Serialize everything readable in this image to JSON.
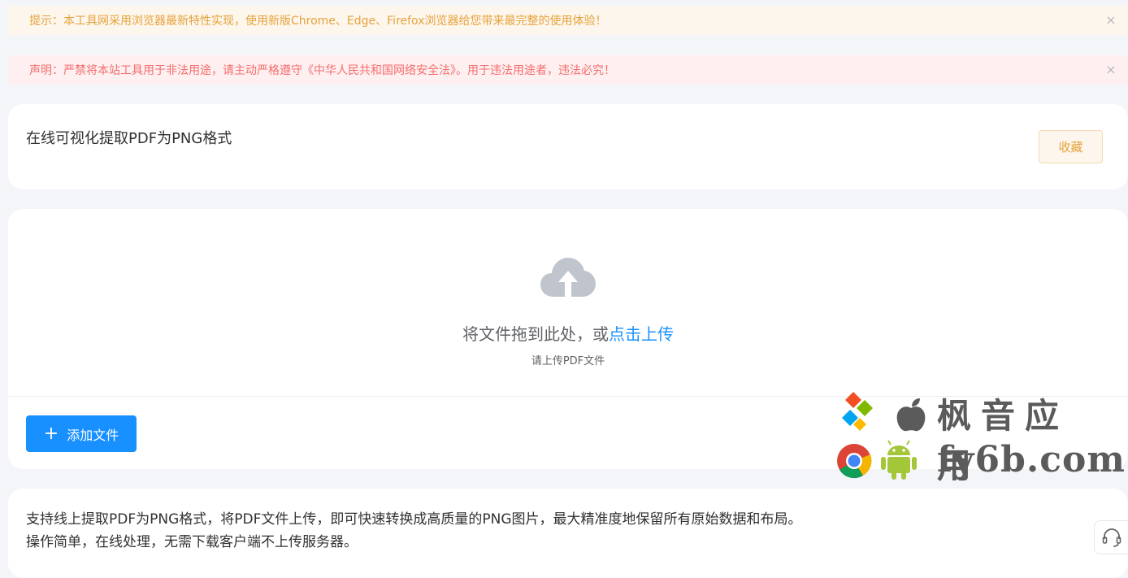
{
  "alerts": {
    "tip": "提示：本工具网采用浏览器最新特性实现，使用新版Chrome、Edge、Firefox浏览器给您带来最完整的使用体验！",
    "warning": "声明：严禁将本站工具用于非法用途，请主动严格遵守《中华人民共和国网络安全法》。用于违法用途者，违法必究！",
    "close_glyph": "×"
  },
  "header": {
    "title": "在线可视化提取PDF为PNG格式",
    "favorite_label": "收藏"
  },
  "upload": {
    "icon": "cloud-upload-icon",
    "drop_text": "将文件拖到此处，或",
    "drop_link": "点击上传",
    "hint": "请上传PDF文件",
    "add_button_icon": "+",
    "add_button_label": "添加文件"
  },
  "description": {
    "line1": "支持线上提取PDF为PNG格式，将PDF文件上传，即可快速转换成高质量的PNG图片，最大精准度地保留所有原始数据和布局。",
    "line2": "操作简单，在线处理，无需下载客户端不上传服务器。"
  },
  "watermark": {
    "cn": "枫音应用",
    "en": "fy6b.com"
  },
  "colors": {
    "primary": "#1890ff",
    "warning": "#e6a23c",
    "danger": "#f56c6c",
    "background": "#f4f5f9"
  },
  "support_icon": "headset-icon"
}
